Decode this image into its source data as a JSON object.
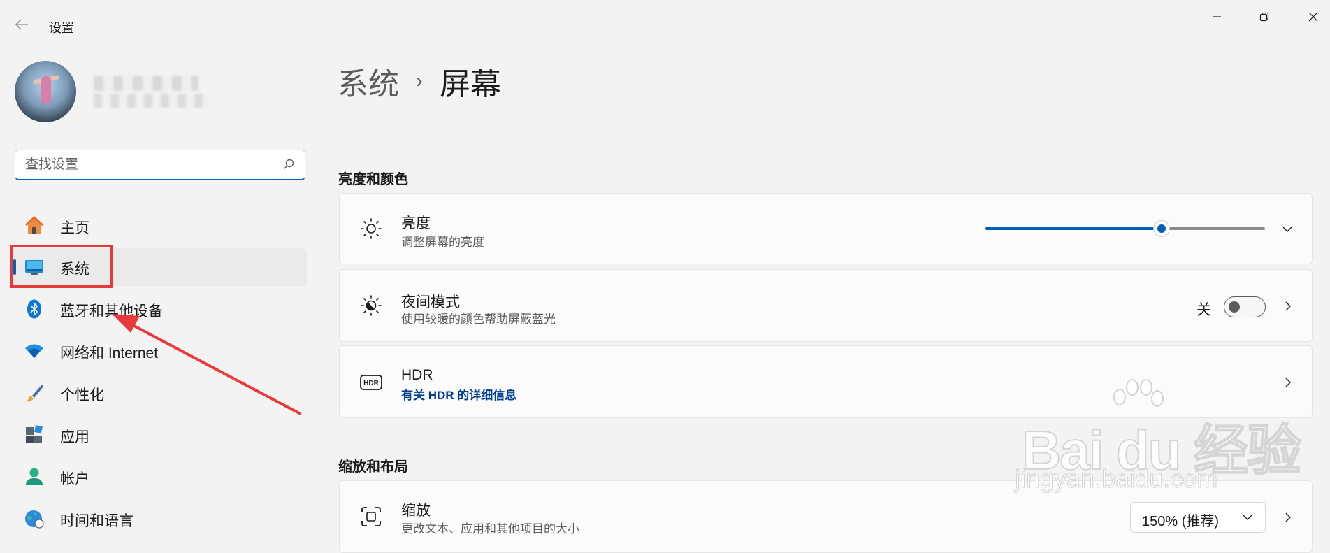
{
  "window": {
    "title": "设置",
    "controls": [
      "minimize-icon",
      "restore-icon",
      "close-icon"
    ]
  },
  "search": {
    "placeholder": "查找设置",
    "value": ""
  },
  "nav": {
    "items": [
      {
        "label": "主页",
        "icon": "home-icon"
      },
      {
        "label": "系统",
        "icon": "system-display-icon",
        "active": true
      },
      {
        "label": "蓝牙和其他设备",
        "icon": "bluetooth-icon"
      },
      {
        "label": "网络和 Internet",
        "icon": "wifi-icon"
      },
      {
        "label": "个性化",
        "icon": "brush-icon"
      },
      {
        "label": "应用",
        "icon": "apps-icon"
      },
      {
        "label": "帐户",
        "icon": "account-icon"
      },
      {
        "label": "时间和语言",
        "icon": "globe-clock-icon"
      }
    ]
  },
  "breadcrumb": {
    "parent": "系统",
    "separator": "›",
    "current": "屏幕"
  },
  "sections": {
    "brightness_color": "亮度和颜色",
    "scale_layout": "缩放和布局"
  },
  "brightness": {
    "title": "亮度",
    "subtitle": "调整屏幕的亮度",
    "level_percent": 63
  },
  "night_mode": {
    "title": "夜间模式",
    "subtitle": "使用较暖的颜色帮助屏蔽蓝光",
    "state": "关"
  },
  "hdr": {
    "title": "HDR",
    "link": "有关 HDR 的详细信息"
  },
  "scale": {
    "title": "缩放",
    "subtitle": "更改文本、应用和其他项目的大小",
    "value": "150% (推荐)"
  },
  "watermark": {
    "brand": "Bai du 经验",
    "url": "jingyan.baidu.com"
  },
  "colors": {
    "accent": "#005fb8",
    "annotation": "#e83a3a",
    "background": "#f3f3f3"
  }
}
